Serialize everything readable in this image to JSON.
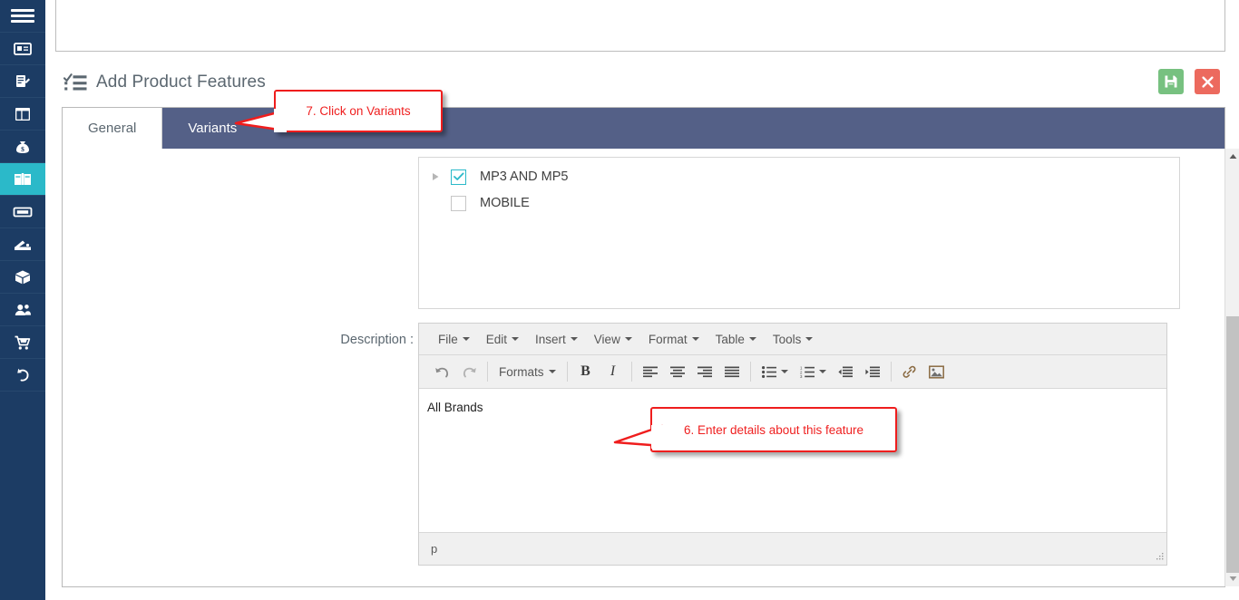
{
  "sidebar": {
    "menu_toggle": "hamburger-menu",
    "items": [
      {
        "icon": "id-card-icon",
        "name": "sidebar-item-contacts"
      },
      {
        "icon": "edit-document-icon",
        "name": "sidebar-item-records"
      },
      {
        "icon": "layout-columns-icon",
        "name": "sidebar-item-dashboard"
      },
      {
        "icon": "money-bag-icon",
        "name": "sidebar-item-finance"
      },
      {
        "icon": "open-book-icon",
        "name": "sidebar-item-catalog",
        "active": true
      },
      {
        "icon": "ticket-icon",
        "name": "sidebar-item-tickets"
      },
      {
        "icon": "wallet-icon",
        "name": "sidebar-item-wallet"
      },
      {
        "icon": "box-icon",
        "name": "sidebar-item-products"
      },
      {
        "icon": "users-icon",
        "name": "sidebar-item-customers"
      },
      {
        "icon": "shopping-cart-icon",
        "name": "sidebar-item-orders"
      },
      {
        "icon": "undo-arrow-icon",
        "name": "sidebar-item-returns"
      }
    ]
  },
  "header": {
    "icon": "checklist-icon",
    "title": "Add Product Features",
    "save_button": "save-icon",
    "close_button": "close-icon"
  },
  "tabs": [
    {
      "label": "General",
      "active": true
    },
    {
      "label": "Variants",
      "active": false
    }
  ],
  "tree": {
    "items": [
      {
        "label": "MP3 AND MP5",
        "checked": true,
        "expandable": true
      },
      {
        "label": "MOBILE",
        "checked": false,
        "expandable": false
      }
    ]
  },
  "form": {
    "description_label": "Description :"
  },
  "editor": {
    "menus": [
      "File",
      "Edit",
      "Insert",
      "View",
      "Format",
      "Table",
      "Tools"
    ],
    "toolbar": [
      {
        "name": "undo-icon",
        "label": ""
      },
      {
        "name": "redo-icon",
        "label": ""
      },
      {
        "name": "formats-dropdown",
        "label": "Formats"
      },
      {
        "name": "bold-icon",
        "label": "B"
      },
      {
        "name": "italic-icon",
        "label": "I"
      },
      {
        "name": "align-left-icon",
        "label": ""
      },
      {
        "name": "align-center-icon",
        "label": ""
      },
      {
        "name": "align-right-icon",
        "label": ""
      },
      {
        "name": "align-justify-icon",
        "label": ""
      },
      {
        "name": "bullet-list-icon",
        "label": ""
      },
      {
        "name": "numbered-list-icon",
        "label": ""
      },
      {
        "name": "outdent-icon",
        "label": ""
      },
      {
        "name": "indent-icon",
        "label": ""
      },
      {
        "name": "link-icon",
        "label": ""
      },
      {
        "name": "image-icon",
        "label": ""
      }
    ],
    "content": "All Brands",
    "status_path": "p"
  },
  "callouts": [
    {
      "id": "callout-7",
      "text": "7. Click on Variants"
    },
    {
      "id": "callout-6",
      "text": "6. Enter details about this feature"
    }
  ],
  "colors": {
    "sidebar_bg": "#1c3c64",
    "sidebar_active": "#2bb9c9",
    "tabbar_bg": "#546087",
    "save_green": "#77c180",
    "close_red": "#ec6a5e",
    "callout_red": "#ef1d1d"
  }
}
